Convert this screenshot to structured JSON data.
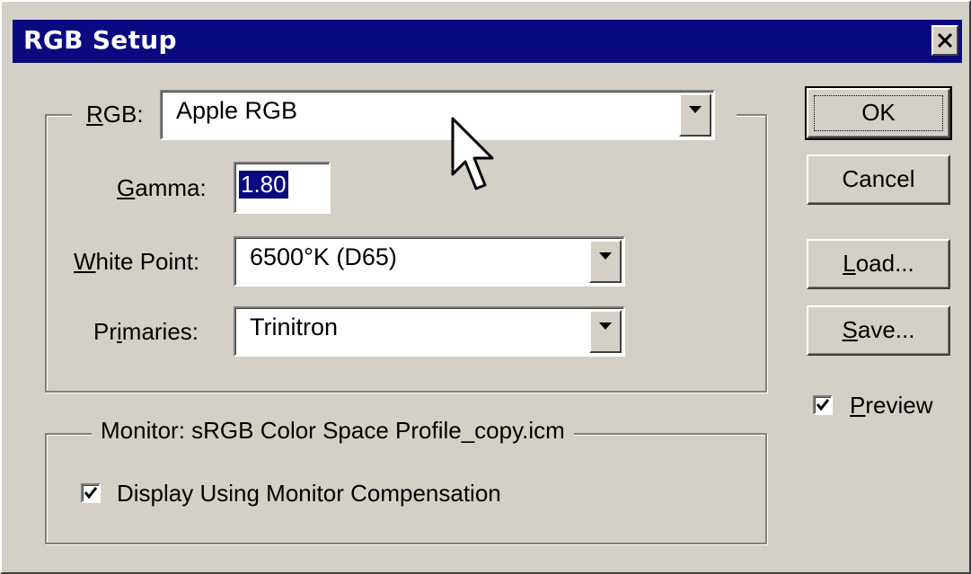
{
  "window": {
    "title": "RGB Setup"
  },
  "rgb_group": {
    "label": "RGB:",
    "rgb_value": "Apple RGB",
    "gamma_label": "Gamma:",
    "gamma_value": "1.80",
    "white_point_label": "White Point:",
    "white_point_value": "6500°K (D65)",
    "primaries_label": "Primaries:",
    "primaries_value": "Trinitron"
  },
  "monitor_group": {
    "label": "Monitor:  sRGB Color Space Profile_copy.icm",
    "compensation_label": "Display Using Monitor Compensation",
    "compensation_checked": true
  },
  "buttons": {
    "ok": "OK",
    "cancel": "Cancel",
    "load": "Load...",
    "save": "Save..."
  },
  "preview": {
    "label": "Preview",
    "checked": true
  },
  "colors": {
    "titlebar": "#0a0a80",
    "face": "#d4d0c8",
    "selection": "#0a0a80"
  },
  "icons": [
    "close-icon",
    "dropdown-arrow-icon",
    "checkmark-icon",
    "mouse-cursor-icon"
  ]
}
